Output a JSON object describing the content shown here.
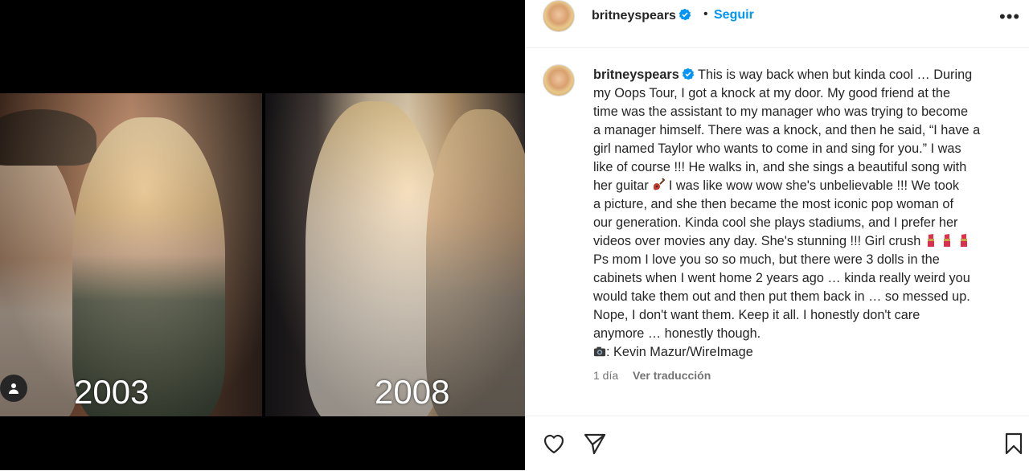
{
  "post": {
    "username": "britneyspears",
    "follow_label": "Seguir",
    "dot": "•",
    "more_label": "•••",
    "caption_lines": [
      "This is way back when but kinda cool … During",
      "my Oops Tour, I got a knock at my door. My good friend at the",
      "time was the assistant to my manager who was trying to become",
      "a manager himself. There was a knock, and then he said, “I have a",
      "girl named Taylor who wants to come in and sing for you.” I was",
      "like of course !!! He walks in, and she sings a beautiful song with",
      "her guitar",
      "I was like wow wow she's unbelievable !!! We took",
      "a picture, and she then became the most iconic pop woman of",
      "our generation. Kinda cool she plays stadiums, and I prefer her",
      "videos over movies any day. She's stunning !!! Girl crush",
      "Ps mom I love you so so much, but there were 3 dolls in the",
      "cabinets when I went home 2 years ago … kinda really weird you",
      "would take them out and then put them back in … so messed up.",
      "Nope, I don't want them. Keep it all. I honestly don't care",
      "anymore … honestly though.",
      ": Kevin Mazur/WireImage"
    ],
    "time_ago": "1 día",
    "translate_label": "Ver traducción"
  },
  "media": {
    "left_year": "2003",
    "right_year": "2008"
  },
  "icons": {
    "verified": "verified-badge-icon",
    "guitar": "guitar-icon",
    "lipstick": "lipstick-icon",
    "camera": "camera-icon",
    "heart": "heart-icon",
    "share": "share-icon",
    "save": "bookmark-icon",
    "tag": "user-tag-icon"
  },
  "colors": {
    "accent": "#0095f6",
    "verified": "#0095f6",
    "text": "#262626",
    "muted": "#737373"
  }
}
